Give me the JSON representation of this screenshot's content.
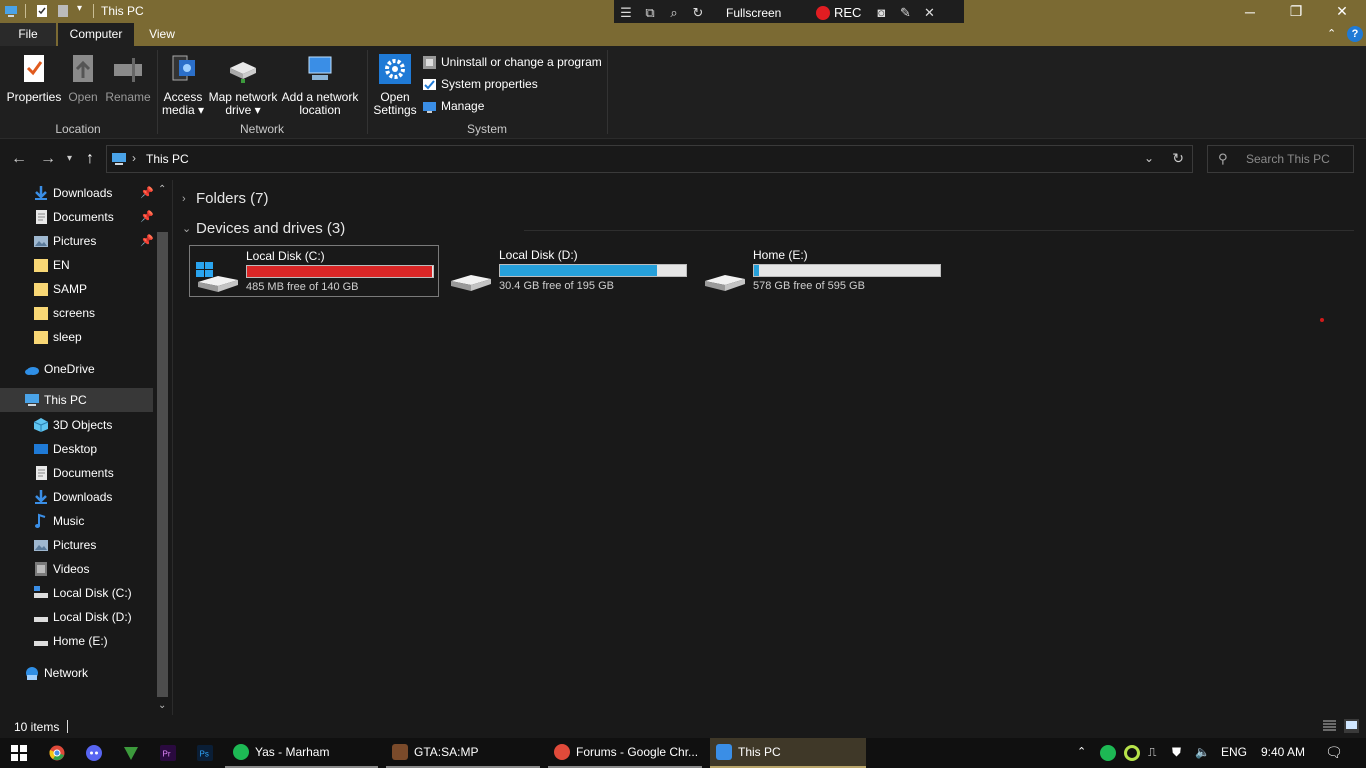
{
  "window": {
    "title": "This PC",
    "controls": {
      "minimize": "─",
      "restore": "❐",
      "close": "✕"
    }
  },
  "recorder": {
    "mode_label": "Fullscreen",
    "rec_label": "REC"
  },
  "ribbon": {
    "tabs": [
      {
        "label": "File"
      },
      {
        "label": "Computer"
      },
      {
        "label": "View"
      }
    ],
    "location": {
      "group_label": "Location",
      "buttons": [
        {
          "label": "Properties"
        },
        {
          "label": "Open"
        },
        {
          "label": "Rename"
        }
      ]
    },
    "network": {
      "group_label": "Network",
      "buttons": [
        {
          "line1": "Access",
          "line2": "media ▾"
        },
        {
          "line1": "Map network",
          "line2": "drive ▾"
        },
        {
          "line1": "Add a network",
          "line2": "location"
        }
      ]
    },
    "system": {
      "group_label": "System",
      "open_settings_line1": "Open",
      "open_settings_line2": "Settings",
      "items": [
        {
          "label": "Uninstall or change a program"
        },
        {
          "label": "System properties"
        },
        {
          "label": "Manage"
        }
      ]
    }
  },
  "address_bar": {
    "crumb": "This PC",
    "search_placeholder": "Search This PC"
  },
  "sidebar": {
    "quick_access": [
      {
        "label": "Downloads",
        "icon": "download-arrow-icon",
        "pinned": true
      },
      {
        "label": "Documents",
        "icon": "document-icon",
        "pinned": true
      },
      {
        "label": "Pictures",
        "icon": "pictures-icon",
        "pinned": true
      },
      {
        "label": "EN",
        "icon": "folder-icon"
      },
      {
        "label": "SAMP",
        "icon": "folder-icon"
      },
      {
        "label": "screens",
        "icon": "folder-icon"
      },
      {
        "label": "sleep",
        "icon": "folder-icon"
      }
    ],
    "onedrive": "OneDrive",
    "this_pc": "This PC",
    "this_pc_items": [
      {
        "label": "3D Objects",
        "icon": "3d-objects-icon"
      },
      {
        "label": "Desktop",
        "icon": "desktop-icon"
      },
      {
        "label": "Documents",
        "icon": "document-icon"
      },
      {
        "label": "Downloads",
        "icon": "download-arrow-icon"
      },
      {
        "label": "Music",
        "icon": "music-icon"
      },
      {
        "label": "Pictures",
        "icon": "pictures-icon"
      },
      {
        "label": "Videos",
        "icon": "videos-icon"
      },
      {
        "label": "Local Disk (C:)",
        "icon": "drive-icon"
      },
      {
        "label": "Local Disk (D:)",
        "icon": "drive-icon"
      },
      {
        "label": "Home (E:)",
        "icon": "drive-icon"
      }
    ],
    "network": "Network"
  },
  "content": {
    "folders_header": "Folders (7)",
    "devices_header": "Devices and drives (3)",
    "drives": [
      {
        "name": "Local Disk (C:)",
        "free": "485 MB free of 140 GB",
        "used_fraction": 0.997,
        "bar_color": "#da2626",
        "system": true
      },
      {
        "name": "Local Disk (D:)",
        "free": "30.4 GB free of 195 GB",
        "used_fraction": 0.844,
        "bar_color": "#26a0da",
        "system": false
      },
      {
        "name": "Home (E:)",
        "free": "578 GB free of 595 GB",
        "used_fraction": 0.029,
        "bar_color": "#26a0da",
        "system": false
      }
    ]
  },
  "status": {
    "item_count": "10 items"
  },
  "taskbar": {
    "apps": [
      {
        "label": "Yas - Marham",
        "icon": "spotify-icon",
        "color": "#1db954"
      },
      {
        "label": "GTA:SA:MP",
        "icon": "gta-icon",
        "color": "#7a4a2a"
      },
      {
        "label": "Forums - Google Chr...",
        "icon": "chrome-icon",
        "color": "#e04a3a"
      },
      {
        "label": "This PC",
        "icon": "this-pc-icon",
        "color": "#3a8ee6"
      }
    ],
    "language": "ENG",
    "time": "9:40 AM"
  }
}
